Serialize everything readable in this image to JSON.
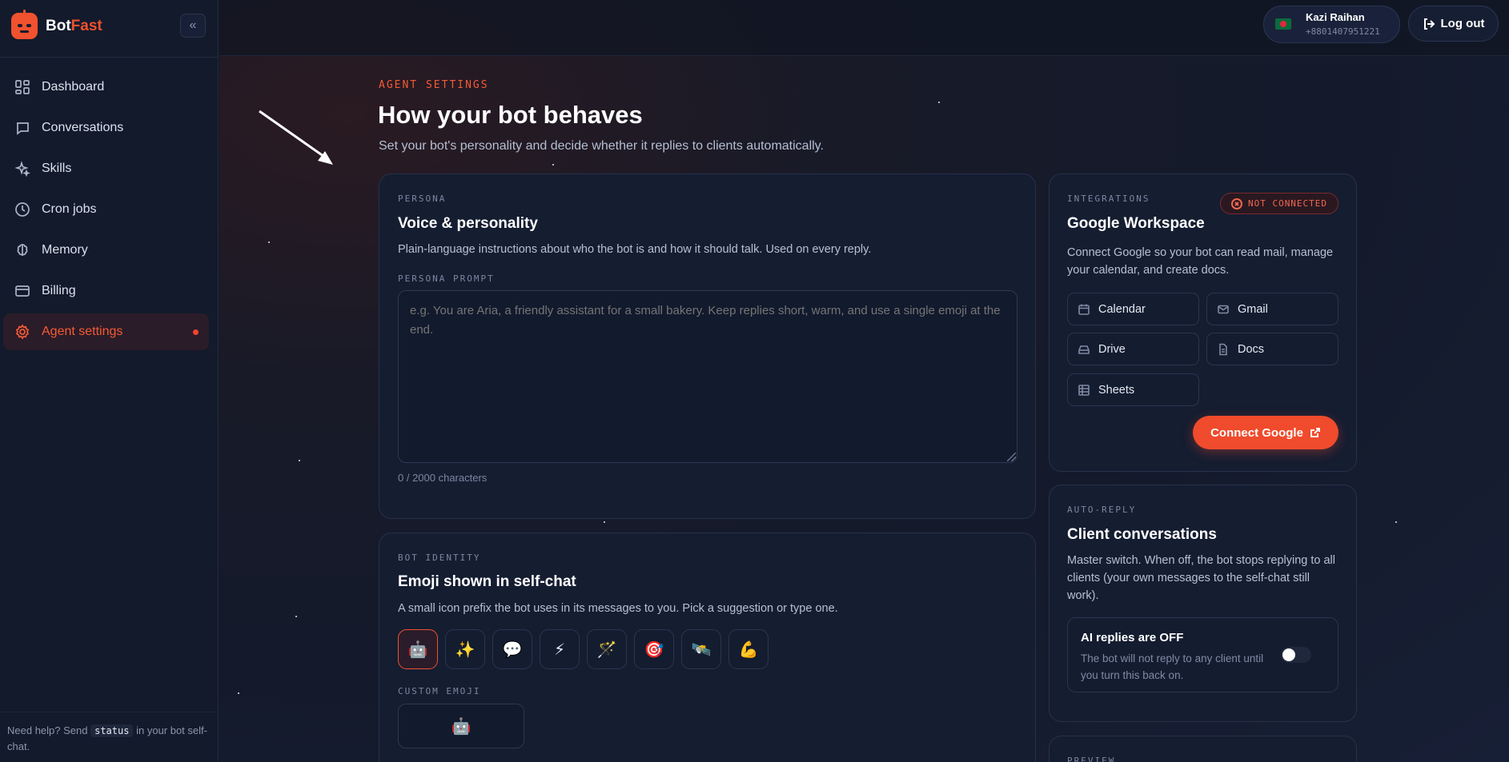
{
  "brand": {
    "part1": "Bot",
    "part2": "Fast"
  },
  "sidebar": {
    "collapse_icon": "chevrons-left-icon",
    "items": [
      {
        "label": "Dashboard",
        "icon": "dashboard-icon"
      },
      {
        "label": "Conversations",
        "icon": "chat-icon"
      },
      {
        "label": "Skills",
        "icon": "sparkles-icon"
      },
      {
        "label": "Cron jobs",
        "icon": "clock-icon"
      },
      {
        "label": "Memory",
        "icon": "brain-icon"
      },
      {
        "label": "Billing",
        "icon": "credit-card-icon"
      },
      {
        "label": "Agent settings",
        "icon": "gear-icon",
        "active": true
      }
    ],
    "help": {
      "prefix": "Need help? Send",
      "code": "status",
      "suffix": "in your bot self-chat."
    }
  },
  "header": {
    "user": {
      "name": "Kazi Raihan",
      "phone": "+8801407951221",
      "flag": "bangladesh-flag"
    },
    "logout_label": "Log out"
  },
  "page": {
    "eyebrow": "AGENT SETTINGS",
    "title": "How your bot behaves",
    "subtitle": "Set your bot's personality and decide whether it replies to clients automatically."
  },
  "persona": {
    "eyebrow": "PERSONA",
    "title": "Voice & personality",
    "desc": "Plain-language instructions about who the bot is and how it should talk. Used on every reply.",
    "field_label": "PERSONA PROMPT",
    "placeholder": "e.g. You are Aria, a friendly assistant for a small bakery. Keep replies short, warm, and use a single emoji at the end.",
    "value": "",
    "counter": "0 / 2000 characters"
  },
  "identity": {
    "eyebrow": "BOT IDENTITY",
    "title": "Emoji shown in self-chat",
    "desc": "A small icon prefix the bot uses in its messages to you. Pick a suggestion or type one.",
    "suggestions": [
      "🤖",
      "✨",
      "💬",
      "⚡",
      "🪄",
      "🎯",
      "🛰️",
      "💪"
    ],
    "custom_label": "CUSTOM EMOJI",
    "custom_value": "🤖"
  },
  "integrations": {
    "eyebrow": "INTEGRATIONS",
    "status": "NOT CONNECTED",
    "title": "Google Workspace",
    "desc": "Connect Google so your bot can read mail, manage your calendar, and create docs.",
    "services": [
      "Calendar",
      "Gmail",
      "Drive",
      "Docs",
      "Sheets"
    ],
    "connect_label": "Connect Google"
  },
  "autoreply": {
    "eyebrow": "AUTO-REPLY",
    "title": "Client conversations",
    "desc": "Master switch. When off, the bot stops replying to all clients (your own messages to the self-chat still work).",
    "toggle_title": "AI replies are OFF",
    "toggle_desc": "The bot will not reply to any client until you turn this back on.",
    "enabled": false
  },
  "preview": {
    "eyebrow": "PREVIEW"
  },
  "colors": {
    "accent": "#f0512f",
    "background": "#121829"
  }
}
